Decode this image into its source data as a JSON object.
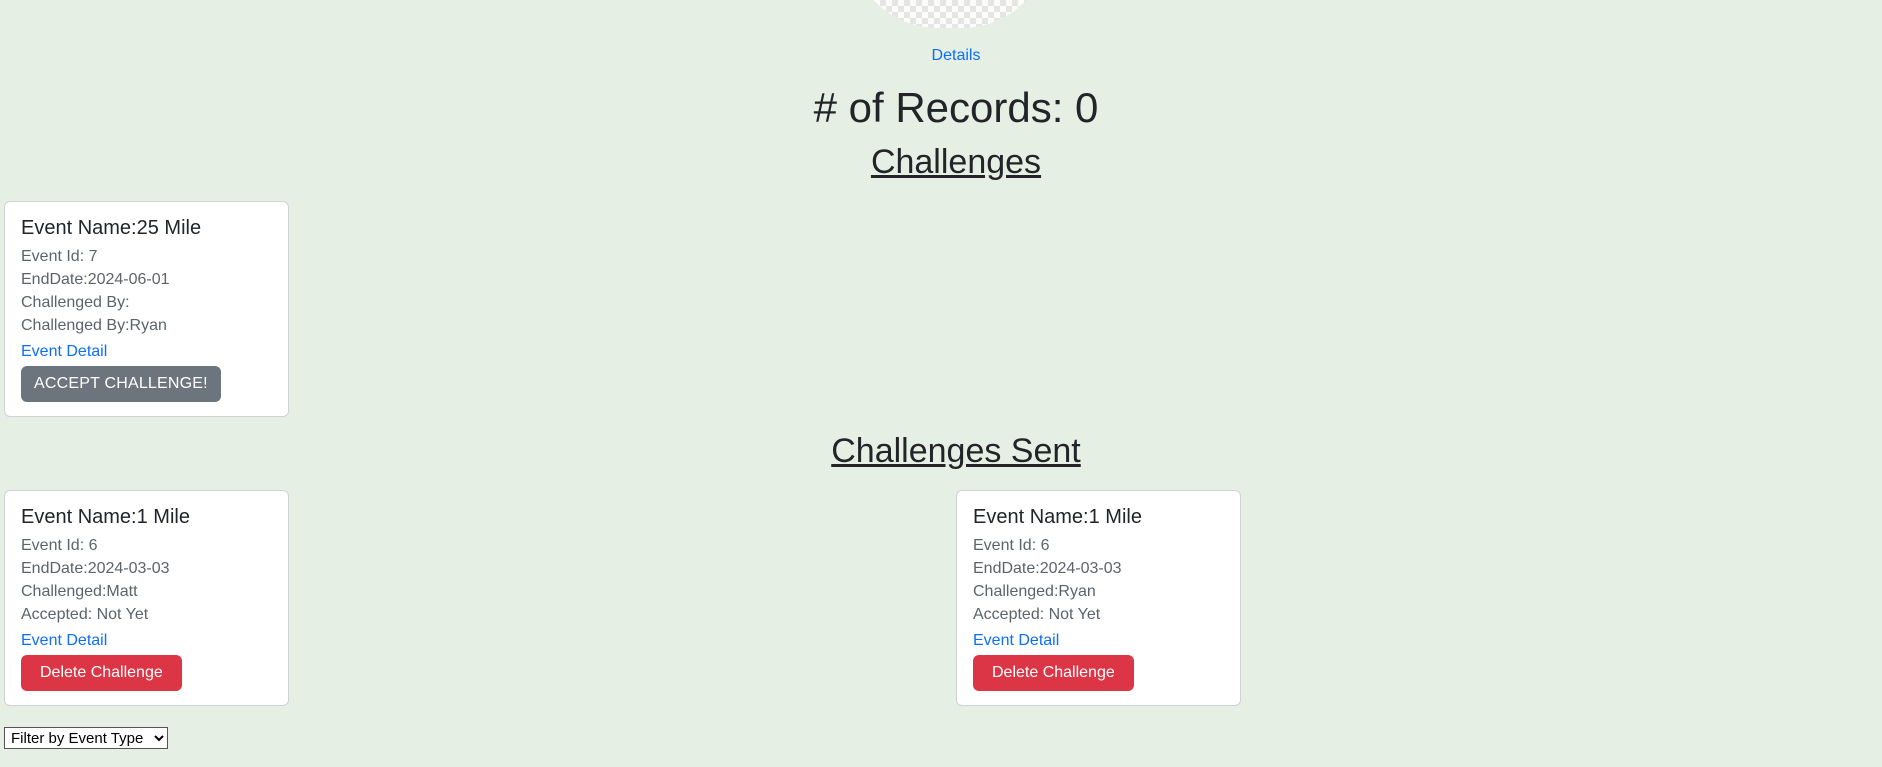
{
  "header": {
    "details_link": "Details",
    "records_heading": "# of Records: 0"
  },
  "challenges": {
    "title": "Challenges",
    "items": [
      {
        "title": "Event Name:25 Mile",
        "lines": [
          "Event Id: 7",
          "EndDate:2024-06-01",
          "Challenged By:",
          "Challenged By:Ryan"
        ],
        "link": "Event Detail",
        "button": "ACCEPT CHALLENGE!"
      }
    ]
  },
  "challenges_sent": {
    "title": "Challenges Sent",
    "items": [
      {
        "title": "Event Name:1 Mile",
        "lines": [
          "Event Id: 6",
          "EndDate:2024-03-03",
          "Challenged:Matt",
          "Accepted: Not Yet"
        ],
        "link": "Event Detail",
        "button": "Delete Challenge"
      },
      {
        "title": "Event Name:1 Mile",
        "lines": [
          "Event Id: 6",
          "EndDate:2024-03-03",
          "Challenged:Ryan",
          "Accepted: Not Yet"
        ],
        "link": "Event Detail",
        "button": "Delete Challenge"
      }
    ]
  },
  "filter": {
    "selected": "Filter by Event Type"
  },
  "colors": {
    "background": "#e6efe3",
    "link": "#0d6efd",
    "accept_button": "#6c757d",
    "delete_button": "#dc3545"
  }
}
